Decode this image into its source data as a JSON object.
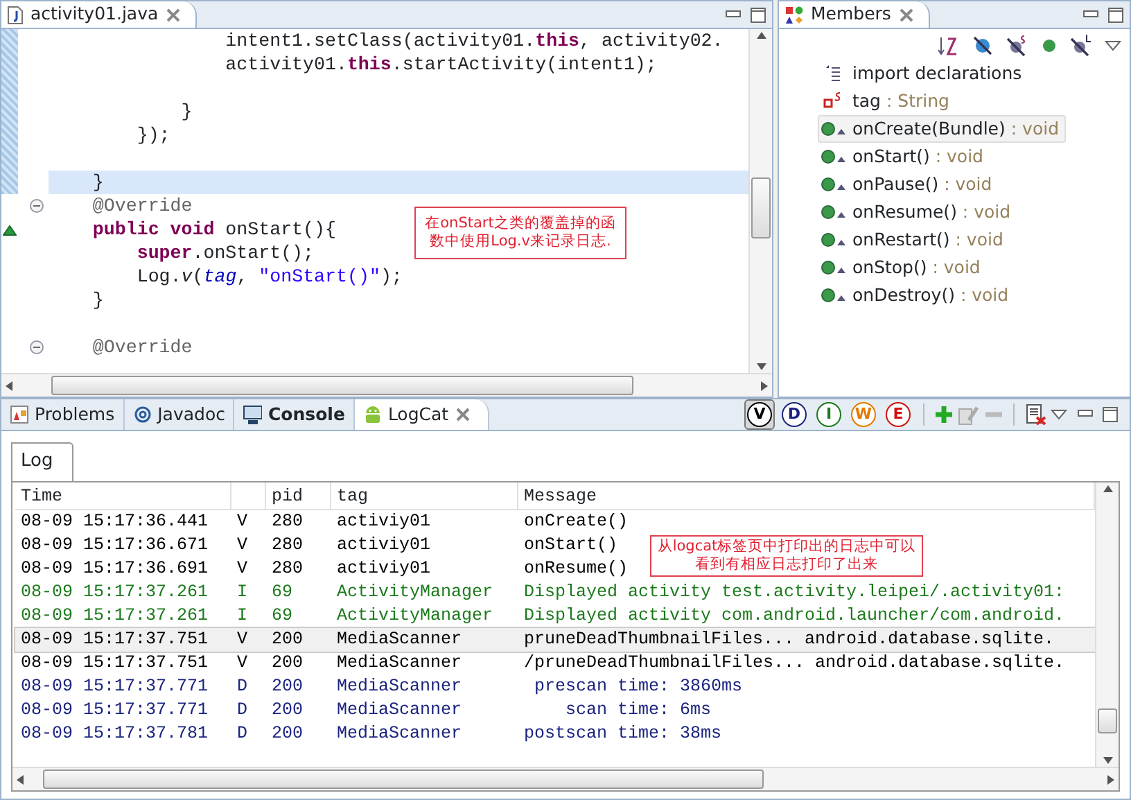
{
  "editor": {
    "tab": {
      "title": "activity01.java",
      "selected": true
    },
    "lines": [
      {
        "kind": "code",
        "current": false,
        "segments": [
          {
            "kind": "plain",
            "text": "                intent1.setClass(activity01."
          },
          {
            "kind": "keyword",
            "text": "this"
          },
          {
            "kind": "plain",
            "text": ", activity02."
          }
        ]
      },
      {
        "kind": "code",
        "current": false,
        "segments": [
          {
            "kind": "plain",
            "text": "                activity01."
          },
          {
            "kind": "keyword",
            "text": "this"
          },
          {
            "kind": "plain",
            "text": ".startActivity(intent1);"
          }
        ]
      },
      {
        "kind": "blank",
        "current": false
      },
      {
        "kind": "code",
        "current": false,
        "segments": [
          {
            "kind": "plain",
            "text": "            }"
          }
        ]
      },
      {
        "kind": "code",
        "current": false,
        "segments": [
          {
            "kind": "plain",
            "text": "        });"
          }
        ]
      },
      {
        "kind": "blank",
        "current": false
      },
      {
        "kind": "code",
        "current": true,
        "segments": [
          {
            "kind": "plain",
            "text": "    }"
          }
        ]
      },
      {
        "kind": "code",
        "current": false,
        "foldable": true,
        "segments": [
          {
            "kind": "annotation",
            "text": "    @Override"
          }
        ]
      },
      {
        "kind": "code",
        "current": false,
        "overrides": true,
        "segments": [
          {
            "kind": "keyword",
            "text": "    public void"
          },
          {
            "kind": "plain",
            "text": " onStart(){"
          }
        ]
      },
      {
        "kind": "code",
        "current": false,
        "segments": [
          {
            "kind": "keyword",
            "text": "        super"
          },
          {
            "kind": "plain",
            "text": ".onStart();"
          }
        ]
      },
      {
        "kind": "code",
        "current": false,
        "segments": [
          {
            "kind": "plain",
            "text": "        Log."
          },
          {
            "kind": "static",
            "text": "v"
          },
          {
            "kind": "plain",
            "text": "("
          },
          {
            "kind": "field",
            "text": "tag"
          },
          {
            "kind": "plain",
            "text": ", "
          },
          {
            "kind": "string",
            "text": "\"onStart()\""
          },
          {
            "kind": "plain",
            "text": ");"
          }
        ]
      },
      {
        "kind": "code",
        "current": false,
        "segments": [
          {
            "kind": "plain",
            "text": "    }"
          }
        ]
      },
      {
        "kind": "blank",
        "current": false
      },
      {
        "kind": "code",
        "current": false,
        "foldable": true,
        "segments": [
          {
            "kind": "annotation",
            "text": "    @Override"
          }
        ]
      }
    ],
    "note": "在onStart之类的覆盖掉的函数中使用Log.v来记录日志."
  },
  "members": {
    "tab": {
      "title": "Members",
      "selected": true
    },
    "items": [
      {
        "kind": "imports",
        "name": "import declarations",
        "selected": false
      },
      {
        "kind": "field",
        "name": "tag",
        "type": " : String",
        "selected": false
      },
      {
        "kind": "method",
        "name": "onCreate(Bundle)",
        "type": " : void",
        "selected": true
      },
      {
        "kind": "method",
        "name": "onStart()",
        "type": " : void",
        "selected": false
      },
      {
        "kind": "method",
        "name": "onPause()",
        "type": " : void",
        "selected": false
      },
      {
        "kind": "method",
        "name": "onResume()",
        "type": " : void",
        "selected": false
      },
      {
        "kind": "method",
        "name": "onRestart()",
        "type": " : void",
        "selected": false
      },
      {
        "kind": "method",
        "name": "onStop()",
        "type": " : void",
        "selected": false
      },
      {
        "kind": "method",
        "name": "onDestroy()",
        "type": " : void",
        "selected": false
      }
    ]
  },
  "bottom_tabs": [
    {
      "kind": "problems",
      "label": "Problems",
      "selected": false,
      "updated": false
    },
    {
      "kind": "javadoc",
      "label": "Javadoc",
      "selected": false,
      "updated": false
    },
    {
      "kind": "console",
      "label": "Console",
      "selected": false,
      "updated": true
    },
    {
      "kind": "logcat",
      "label": "LogCat",
      "selected": true,
      "updated": false
    }
  ],
  "log_filters": [
    {
      "letter": "V",
      "color": "#000000",
      "selected": true
    },
    {
      "letter": "D",
      "color": "#1a237e",
      "selected": false
    },
    {
      "letter": "I",
      "color": "#1b7a1b",
      "selected": false
    },
    {
      "letter": "W",
      "color": "#e07b00",
      "selected": false
    },
    {
      "letter": "E",
      "color": "#d01010",
      "selected": false
    }
  ],
  "log": {
    "tab": "Log",
    "columns": [
      "Time",
      "pid",
      "tag",
      "Message"
    ],
    "rows": [
      {
        "time": "08-09 15:17:36.441",
        "priority": "V",
        "pid": "280",
        "tag": "activiy01",
        "message": "onCreate()",
        "selected": false
      },
      {
        "time": "08-09 15:17:36.671",
        "priority": "V",
        "pid": "280",
        "tag": "activiy01",
        "message": "onStart()",
        "selected": false
      },
      {
        "time": "08-09 15:17:36.691",
        "priority": "V",
        "pid": "280",
        "tag": "activiy01",
        "message": "onResume()",
        "selected": false
      },
      {
        "time": "08-09 15:17:37.261",
        "priority": "I",
        "pid": "69",
        "tag": "ActivityManager",
        "message": "Displayed activity test.activity.leipei/.activity01:",
        "selected": false
      },
      {
        "time": "08-09 15:17:37.261",
        "priority": "I",
        "pid": "69",
        "tag": "ActivityManager",
        "message": "Displayed activity com.android.launcher/com.android.",
        "selected": false
      },
      {
        "time": "08-09 15:17:37.751",
        "priority": "V",
        "pid": "200",
        "tag": "MediaScanner",
        "message": "pruneDeadThumbnailFiles... android.database.sqlite.",
        "selected": true
      },
      {
        "time": "08-09 15:17:37.751",
        "priority": "V",
        "pid": "200",
        "tag": "MediaScanner",
        "message": "/pruneDeadThumbnailFiles... android.database.sqlite.",
        "selected": false
      },
      {
        "time": "08-09 15:17:37.771",
        "priority": "D",
        "pid": "200",
        "tag": "MediaScanner",
        "message": " prescan time: 3860ms",
        "selected": false
      },
      {
        "time": "08-09 15:17:37.771",
        "priority": "D",
        "pid": "200",
        "tag": "MediaScanner",
        "message": "    scan time: 6ms",
        "selected": false
      },
      {
        "time": "08-09 15:17:37.781",
        "priority": "D",
        "pid": "200",
        "tag": "MediaScanner",
        "message": "postscan time: 38ms",
        "selected": false
      }
    ],
    "note": "从logcat标签页中打印出的日志中可以看到有相应日志打印了出来"
  }
}
